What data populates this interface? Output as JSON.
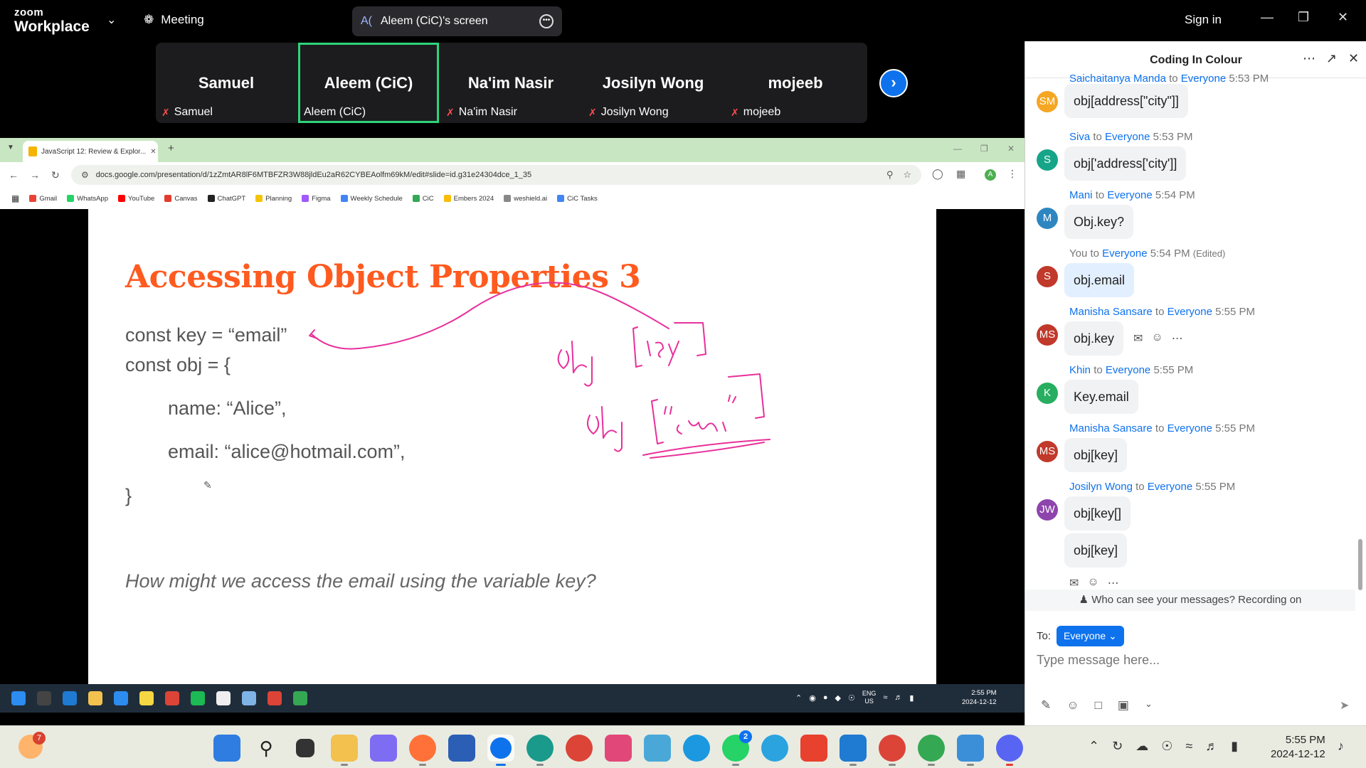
{
  "zoom": {
    "logo_small": "zoom",
    "logo_big": "Workplace",
    "meeting_label": "Meeting",
    "share_badge": "A(",
    "share_label": "Aleem (CiC)'s screen",
    "signin": "Sign in"
  },
  "participants": [
    {
      "name": "Samuel",
      "label": "Samuel",
      "muted": true,
      "active": false
    },
    {
      "name": "Aleem (CiC)",
      "label": "Aleem (CiC)",
      "muted": false,
      "active": true
    },
    {
      "name": "Na'im Nasir",
      "label": "Na'im Nasir",
      "muted": true,
      "active": false
    },
    {
      "name": "Josilyn Wong",
      "label": "Josilyn Wong",
      "muted": true,
      "active": false
    },
    {
      "name": "mojeeb",
      "label": "mojeeb",
      "muted": true,
      "active": false
    }
  ],
  "browser": {
    "tab_title": "JavaScript 12: Review & Explor...",
    "url": "docs.google.com/presentation/d/1zZmtAR8lF6MTBFZR3W88jldEu2aR62CYBEAolfm69kM/edit#slide=id.g31e24304dce_1_35",
    "profile": "A",
    "bookmarks": [
      {
        "label": "Gmail",
        "color": "#ea4335"
      },
      {
        "label": "WhatsApp",
        "color": "#25d366"
      },
      {
        "label": "YouTube",
        "color": "#ff0000"
      },
      {
        "label": "Canvas",
        "color": "#e23b2e"
      },
      {
        "label": "ChatGPT",
        "color": "#222222"
      },
      {
        "label": "Planning",
        "color": "#f5c400"
      },
      {
        "label": "Figma",
        "color": "#a259ff"
      },
      {
        "label": "Weekly Schedule",
        "color": "#4285f4"
      },
      {
        "label": "CiC",
        "color": "#34a853"
      },
      {
        "label": "Embers 2024",
        "color": "#fbbc04"
      },
      {
        "label": "weshield.ai",
        "color": "#888888"
      },
      {
        "label": "CiC Tasks",
        "color": "#4285f4"
      }
    ]
  },
  "slide": {
    "title": "Accessing Object Properties 3",
    "line1": "const key = “email”",
    "line2": "const obj = {",
    "line3": "name: “Alice”,",
    "line4": "email: “alice@hotmail.com”,",
    "line5": "}",
    "question": "How might we access the email using the variable key?",
    "ink_color": "#e8309b"
  },
  "remote_taskbar": {
    "lang": "ENG",
    "region": "US",
    "time": "2:55 PM",
    "date": "2024-12-12"
  },
  "chat": {
    "title": "Coding In Colour",
    "messages": [
      {
        "initials": "SM",
        "color": "#f5a623",
        "sender": "Saichaitanya Manda",
        "to": "to",
        "target": "Everyone",
        "time": "5:53 PM",
        "edited": "",
        "text": "obj[address[\"city\"]]"
      },
      {
        "initials": "S",
        "color": "#17a589",
        "sender": "Siva",
        "to": "to",
        "target": "Everyone",
        "time": "5:53 PM",
        "edited": "",
        "text": "obj['address['city']]"
      },
      {
        "initials": "M",
        "color": "#2e86c1",
        "sender": "Mani",
        "to": "to",
        "target": "Everyone",
        "time": "5:54 PM",
        "edited": "",
        "text": "Obj.key?"
      },
      {
        "initials": "S",
        "color": "#c0392b",
        "sender": "You",
        "to": "to",
        "target": "Everyone",
        "time": "5:54 PM",
        "edited": "(Edited)",
        "text": "obj.email"
      },
      {
        "initials": "MS",
        "color": "#c0392b",
        "sender": "Manisha Sansare",
        "to": "to",
        "target": "Everyone",
        "time": "5:55 PM",
        "edited": "",
        "text": "obj.key"
      },
      {
        "initials": "K",
        "color": "#27ae60",
        "sender": "Khin",
        "to": "to",
        "target": "Everyone",
        "time": "5:55 PM",
        "edited": "",
        "text": "Key.email"
      },
      {
        "initials": "MS",
        "color": "#c0392b",
        "sender": "Manisha Sansare",
        "to": "to",
        "target": "Everyone",
        "time": "5:55 PM",
        "edited": "",
        "text": "obj[key]"
      },
      {
        "initials": "JW",
        "color": "#8e44ad",
        "sender": "Josilyn Wong",
        "to": "to",
        "target": "Everyone",
        "time": "5:55 PM",
        "edited": "",
        "text": "obj[key[]"
      }
    ],
    "extra_bubble": "obj[key]",
    "visibility_note": "Who can see your messages? Recording on",
    "to_label": "To:",
    "recipient": "Everyone",
    "input_placeholder": "Type message here..."
  },
  "host_taskbar": {
    "weather_badge": "7",
    "whatsapp_badge": "2",
    "time": "5:55 PM",
    "date": "2024-12-12"
  }
}
